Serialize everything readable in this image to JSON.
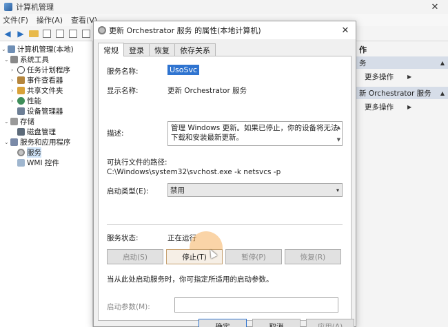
{
  "mmc": {
    "title": "计算机管理",
    "close_glyph": "✕",
    "menu": [
      "文件(F)",
      "操作(A)",
      "查看(V)"
    ],
    "tree": {
      "root": "计算机管理(本地)",
      "system_tools": "系统工具",
      "task_scheduler": "任务计划程序",
      "event_viewer": "事件查看器",
      "shared_folders": "共享文件夹",
      "performance": "性能",
      "device_manager": "设备管理器",
      "storage": "存储",
      "disk_management": "磁盘管理",
      "services_apps": "服务和应用程序",
      "services": "服务",
      "wmi": "WMI 控件"
    },
    "actions": {
      "header": "作",
      "section1_more": "更多操作",
      "section2_title": "新 Orchestrator 服务",
      "section2_more": "更多操作"
    }
  },
  "dialog": {
    "title": "更新 Orchestrator 服务 的属性(本地计算机)",
    "close_glyph": "✕",
    "tabs": [
      "常规",
      "登录",
      "恢复",
      "依存关系"
    ],
    "service_name_label": "服务名称:",
    "service_name_value": "UsoSvc",
    "display_name_label": "显示名称:",
    "display_name_value": "更新 Orchestrator 服务",
    "description_label": "描述:",
    "description_value": "管理 Windows 更新。如果已停止，你的设备将无法下载和安装最新更新。",
    "exe_path_label": "可执行文件的路径:",
    "exe_path_value": "C:\\Windows\\system32\\svchost.exe -k netsvcs -p",
    "startup_type_label": "启动类型(E):",
    "startup_type_value": "禁用",
    "status_label": "服务状态:",
    "status_value": "正在运行",
    "buttons": {
      "start": "启动(S)",
      "stop": "停止(T)",
      "pause": "暂停(P)",
      "resume": "恢复(R)"
    },
    "hint": "当从此处启动服务时，你可指定所适用的启动参数。",
    "start_params_label": "启动参数(M):",
    "start_params_value": "",
    "footer": {
      "ok": "确定",
      "cancel": "取消",
      "apply": "应用(A)"
    }
  }
}
